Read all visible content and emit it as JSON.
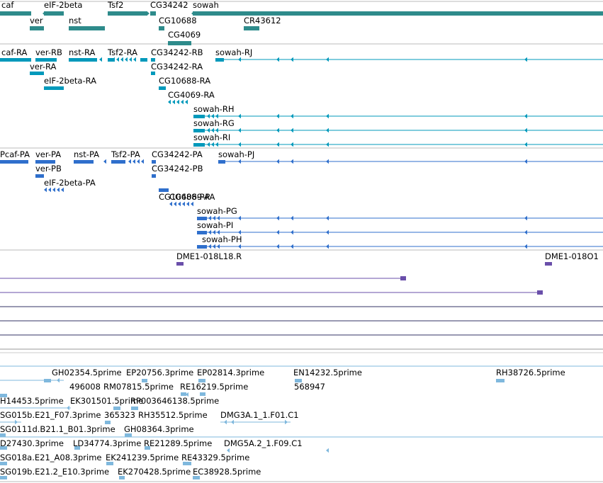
{
  "colors": {
    "gene": "#2e8b8b",
    "transcript": "#0099bb",
    "protein": "#2f6fcc",
    "mapped": "#6a4faa",
    "est": "#7fb8dd",
    "separator": "#9a9a9a"
  },
  "tracks": {
    "genes": {
      "labels": [
        "caf",
        "eIF-2beta",
        "Tsf2",
        "CG34242",
        "sowah",
        "ver",
        "nst",
        "CG10688",
        "CR43612",
        "CG4069"
      ]
    },
    "transcripts": {
      "labels": [
        "caf-RA",
        "ver-RB",
        "nst-RA",
        "Tsf2-RA",
        "CG34242-RB",
        "sowah-RJ",
        "ver-RA",
        "CG34242-RA",
        "eIF-2beta-RA",
        "CG10688-RA",
        "CG4069-RA",
        "sowah-RH",
        "sowah-RG",
        "sowah-RI"
      ]
    },
    "proteins": {
      "labels": [
        "Pcaf-PA",
        "ver-PA",
        "nst-PA",
        "Tsf2-PA",
        "CG34242-PA",
        "sowah-PJ",
        "ver-PB",
        "CG34242-PB",
        "eIF-2beta-PA",
        "CG10688-PA",
        "CG4069-PA",
        "sowah-PG",
        "sowah-PI",
        "sowah-PH"
      ]
    },
    "mapped": {
      "labels": [
        "DME1-018L18.R",
        "DME1-018O1"
      ]
    },
    "ests": {
      "labels": [
        "GH02354.5prime",
        "EP20756.3prime",
        "EP02814.3prime",
        "EN14232.5prime",
        "RH38726.5prime",
        "496008",
        "RM07815.5prime",
        "RE16219.5prime",
        "568947",
        "H14453.5prime",
        "EK301501.5prime",
        "RP003646138.5prime",
        "SG015b.E21_F07.3prime",
        "365323",
        "RH35512.5prime",
        "DMG3A.1_1.F01.C1",
        "SG0111d.B21.1_B01.3prime",
        "GH08364.3prime",
        "D27430.3prime",
        "LD34774.3prime",
        "RE21289.5prime",
        "DMG5A.2_1.F09.C1",
        "SG018a.E21_A08.3prime",
        "EK241239.5prime",
        "RE43329.5prime",
        "SG019b.E21.2_E10.3prime",
        "EK270428.5prime",
        "EC38928.5prime"
      ]
    }
  }
}
